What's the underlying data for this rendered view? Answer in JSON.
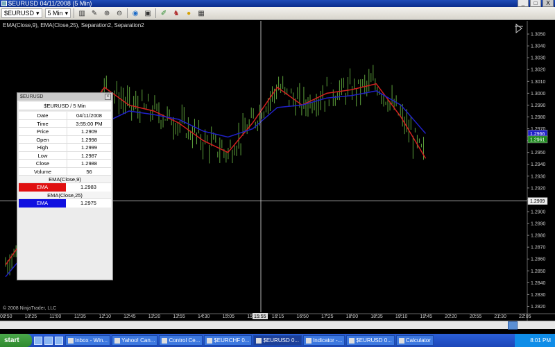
{
  "window": {
    "title": "$EURUSD  04/11/2008 (5 Min)",
    "buttons": [
      "_",
      "□",
      "X"
    ]
  },
  "toolbar": {
    "instrument": "$EURUSD",
    "interval": "5 Min",
    "icons": [
      "bar-type-icon",
      "draw-icon",
      "zoom-in-icon",
      "zoom-out-icon",
      "globe-icon",
      "data-box-icon",
      "properties-icon",
      "strategy-icon",
      "alert-icon",
      "link-icon"
    ]
  },
  "chart": {
    "indicator_label": "EMA(Close,9), EMA(Close,25), Separation2, Separation2",
    "copyright": "© 2008 NinjaTrader, LLC",
    "crosshair_time": "15:55",
    "price_markers": {
      "ema25": "1.2966",
      "ema9": "1.2961",
      "crosshair": "1.2909"
    },
    "colors": {
      "ema9": "#d42020",
      "ema25": "#2020c8",
      "bars": "#5c9f3a",
      "background": "#000000"
    }
  },
  "chart_data": {
    "type": "line",
    "title": "",
    "xlabel": "",
    "ylabel": "",
    "ylim": [
      1.2815,
      1.306
    ],
    "yticks": [
      "1.3050",
      "1.3040",
      "1.3030",
      "1.3020",
      "1.3010",
      "1.3000",
      "1.2990",
      "1.2980",
      "1.2970",
      "1.2960",
      "1.2950",
      "1.2940",
      "1.2930",
      "1.2920",
      "1.2910",
      "1.2900",
      "1.2890",
      "1.2880",
      "1.2870",
      "1.2860",
      "1.2850",
      "1.2840",
      "1.2830",
      "1.2820"
    ],
    "xticks": [
      "09:50",
      "10:25",
      "11:00",
      "11:35",
      "12:10",
      "12:45",
      "13:20",
      "13:55",
      "14:30",
      "15:05",
      "15:40",
      "16:15",
      "16:50",
      "17:25",
      "18:00",
      "18:35",
      "19:10",
      "19:45",
      "20:20",
      "20:55",
      "21:30",
      "22:05"
    ],
    "series": [
      {
        "name": "EMA(Close,9)",
        "x": [
          "09:50",
          "10:25",
          "11:00",
          "11:35",
          "12:10",
          "12:45",
          "13:20",
          "13:55",
          "14:30",
          "15:05",
          "15:40",
          "16:15",
          "16:50",
          "17:25",
          "18:00",
          "18:35",
          "19:10",
          "19:45"
        ],
        "values": [
          1.2855,
          1.2885,
          1.294,
          1.2975,
          1.3005,
          1.299,
          1.2985,
          1.2975,
          1.296,
          1.295,
          1.2975,
          1.3005,
          1.299,
          1.3,
          1.3003,
          1.3008,
          1.298,
          1.2945
        ]
      },
      {
        "name": "EMA(Close,25)",
        "x": [
          "09:50",
          "10:25",
          "11:00",
          "11:35",
          "12:10",
          "12:45",
          "13:20",
          "13:55",
          "14:30",
          "15:05",
          "15:40",
          "16:15",
          "16:50",
          "17:25",
          "18:00",
          "18:35",
          "19:10",
          "19:45"
        ],
        "values": [
          1.2845,
          1.287,
          1.2915,
          1.295,
          1.2975,
          1.2985,
          1.2982,
          1.2978,
          1.2968,
          1.2963,
          1.297,
          1.2988,
          1.299,
          1.2996,
          1.2998,
          1.3002,
          1.299,
          1.2966
        ]
      }
    ]
  },
  "data_window": {
    "title": "$EURUSD",
    "header": "$EURUSD / 5 Min",
    "rows": [
      {
        "k": "Date",
        "v": "04/11/2008"
      },
      {
        "k": "Time",
        "v": "3:55:00 PM"
      },
      {
        "k": "Price",
        "v": "1.2909"
      },
      {
        "k": "Open",
        "v": "1.2998"
      },
      {
        "k": "High",
        "v": "1.2999"
      },
      {
        "k": "Low",
        "v": "1.2987"
      },
      {
        "k": "Close",
        "v": "1.2988"
      },
      {
        "k": "Volume",
        "v": "56"
      }
    ],
    "ema9_header": "EMA(Close,9)",
    "ema9": {
      "k": "EMA",
      "v": "1.2983"
    },
    "ema25_header": "EMA(Close,25)",
    "ema25": {
      "k": "EMA",
      "v": "1.2975"
    }
  },
  "taskbar": {
    "start": "start",
    "buttons": [
      "Inbox - Win...",
      "Yahoo! Can...",
      "Control Ce...",
      "$EURCHF 0...",
      "$EURUSD 0...",
      "Indicator -...",
      "$EURUSD 0...",
      "Calculator"
    ],
    "clock": "8:01 PM"
  }
}
